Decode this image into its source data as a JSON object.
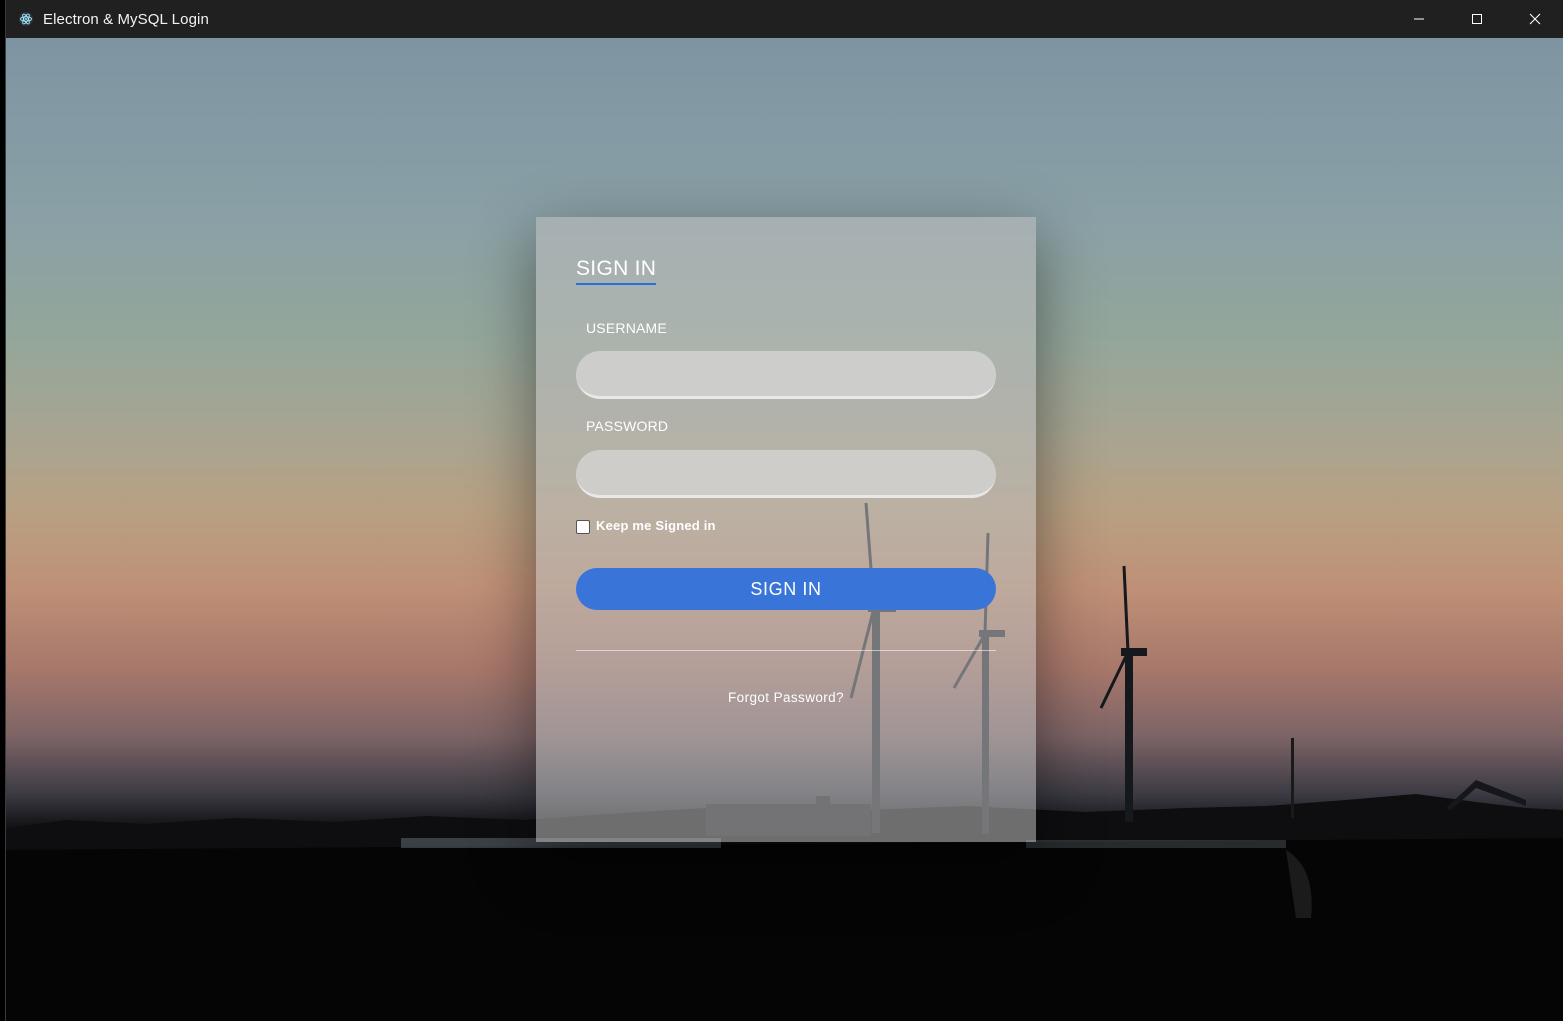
{
  "window": {
    "title": "Electron & MySQL Login",
    "icons": {
      "app": "electron-icon",
      "minimize": "minimize-icon",
      "maximize": "maximize-icon",
      "close": "close-icon"
    }
  },
  "login": {
    "heading": "SIGN IN",
    "username_label": "USERNAME",
    "username_value": "",
    "password_label": "PASSWORD",
    "password_value": "",
    "keep_signed_in_label": "Keep me Signed in",
    "keep_signed_in_checked": false,
    "submit_label": "SIGN IN",
    "forgot_label": "Forgot Password?"
  },
  "colors": {
    "accent": "#3974d9",
    "titlebar": "#202020"
  }
}
